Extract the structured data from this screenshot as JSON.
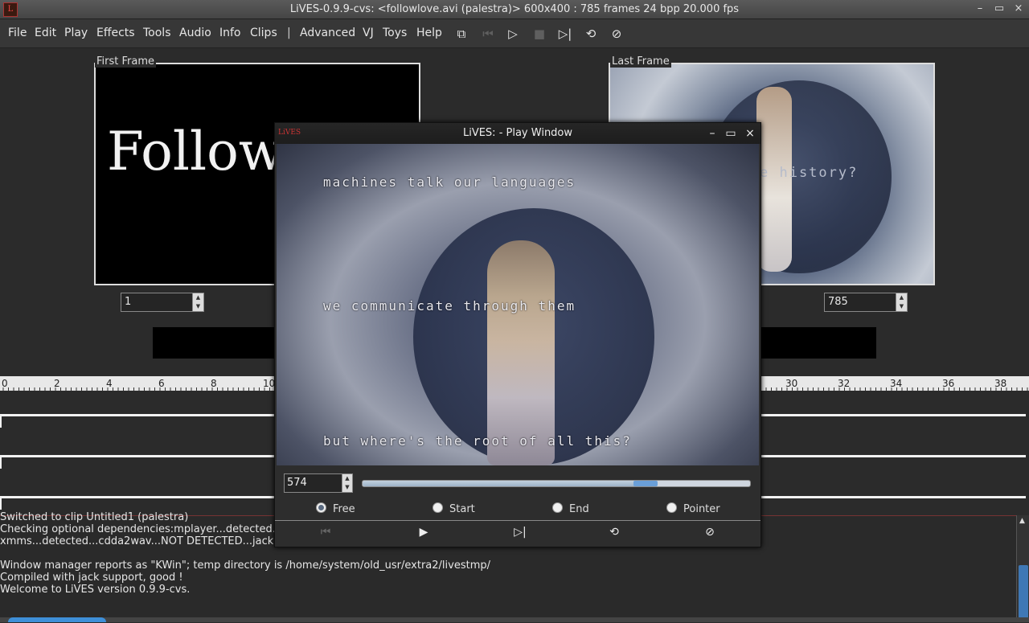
{
  "window": {
    "title": "LiVES-0.9.9-cvs: <followlove.avi (palestra)> 600x400 : 785 frames 24 bpp 20.000 fps",
    "app_icon_text": "L",
    "minimize": "–",
    "maximize": "▭",
    "close": "×"
  },
  "menubar": {
    "items": [
      "File",
      "Edit",
      "Play",
      "Effects",
      "Tools",
      "Audio",
      "Info",
      "Clips"
    ],
    "separator": "|",
    "items2": [
      "Advanced",
      "VJ",
      "Toys",
      "Help"
    ]
  },
  "toolbar": {
    "icons": [
      "fullscreen-icon",
      "rewind-icon",
      "play-icon",
      "stop-icon",
      "play-selection-icon",
      "loop-icon",
      "mute-icon"
    ]
  },
  "first_frame": {
    "label": "First Frame",
    "image_text": "Follow",
    "spin_value": "1"
  },
  "last_frame": {
    "label": "Last Frame",
    "image_text": "e history?",
    "spin_value": "785"
  },
  "ruler": {
    "labels": [
      "0",
      "2",
      "4",
      "6",
      "8",
      "10",
      "30",
      "32",
      "34",
      "36",
      "38"
    ]
  },
  "log": {
    "lines": [
      "Switched to clip Untitled1 (palestra)",
      "Checking optional dependencies:mplayer...detected...",
      "xmms...detected...cdda2wav...NOT DETECTED...jackd...",
      "",
      "Window manager reports as \"KWin\"; temp directory is /home/system/old_usr/extra2/livestmp/",
      "Compiled with jack support, good !",
      "Welcome to LiVES version 0.9.9-cvs."
    ]
  },
  "play_window": {
    "title": "LiVES: - Play Window",
    "icon_text": "LiVES",
    "minimize": "–",
    "maximize": "▭",
    "close": "×",
    "video_texts": [
      "machines talk our languages",
      "we communicate through them",
      "but where's the root of all this?"
    ],
    "frame_value": "574",
    "progress": 0.73,
    "radios": [
      {
        "label": "Free",
        "selected": true
      },
      {
        "label": "Start",
        "selected": false
      },
      {
        "label": "End",
        "selected": false
      },
      {
        "label": "Pointer",
        "selected": false
      }
    ],
    "buttons": [
      "rewind-icon",
      "play-icon",
      "play-selection-icon",
      "loop-icon",
      "mute-icon"
    ]
  },
  "colors": {
    "background": "#2b2b2b",
    "accent": "#3e8fd8",
    "titlebar": "#4a4a4a"
  }
}
